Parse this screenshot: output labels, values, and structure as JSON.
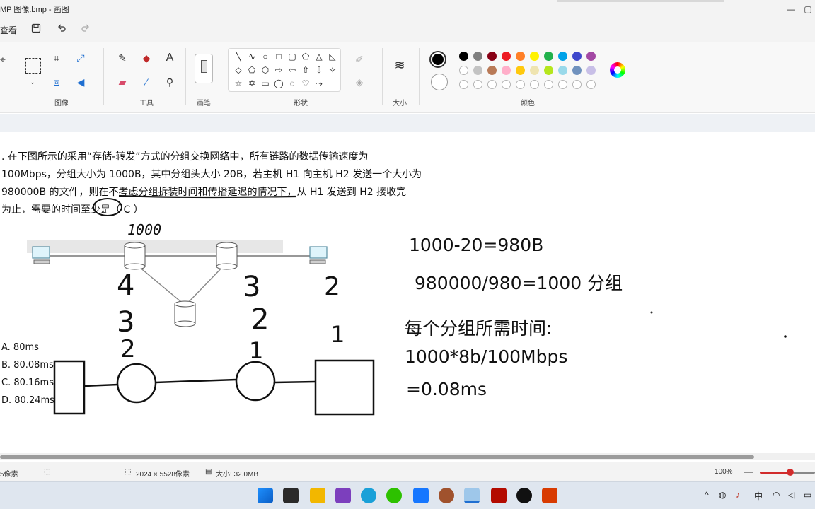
{
  "window": {
    "title": "MP 图像.bmp - 画图",
    "minimize": "—",
    "maximize": "▢"
  },
  "quickbar": {
    "view_label": "查看"
  },
  "ribbon": {
    "groups": {
      "image": "图像",
      "tools": "工具",
      "brushes": "画笔",
      "shapes": "形状",
      "size": "大小",
      "colors": "颜色"
    },
    "text_tool": "A",
    "shapes": [
      "╲",
      "∿",
      "○",
      "□",
      "▢",
      "⬠",
      "△",
      "◺",
      "◇",
      "⬠",
      "⬡",
      "⇨",
      "⇦",
      "⇧",
      "⇩",
      "✧",
      "☆",
      "✡",
      "▭",
      "◯",
      "◌",
      "♡",
      "⤳"
    ],
    "palette_row1": [
      "#000000",
      "#7f7f7f",
      "#880015",
      "#ed1c24",
      "#ff7f27",
      "#fff200",
      "#22b14c",
      "#00a2e8",
      "#3f48cc",
      "#a349a4"
    ],
    "palette_row2": [
      "#ffffff",
      "#c3c3c3",
      "#b97a57",
      "#ffaec9",
      "#ffc90e",
      "#efe4b0",
      "#b5e61d",
      "#99d9ea",
      "#7092be",
      "#c8bfe7"
    ],
    "color1": "#000000",
    "color2": "#ffffff"
  },
  "question": {
    "line1": ". 在下图所示的采用“存储-转发”方式的分组交换网络中，所有链路的数据传输速度为",
    "line2": "100Mbps，分组大小为 1000B，其中分组头大小 20B，若主机 H1 向主机 H2 发送一个大小为",
    "line3": "980000B 的文件，则在不考虑分组拆装时间和传播延迟的情况下，从 H1 发送到 H2 接收完",
    "line4": "为止，需要的时间至少是（  C  ）",
    "options": [
      "A. 80ms",
      "B. 80.08ms",
      "C. 80.16ms",
      "D. 80.24ms"
    ]
  },
  "handwriting": {
    "top": "1000",
    "n4": "4",
    "n3a": "3",
    "n2a": "2",
    "n3b": "3",
    "n2b": "2",
    "n1a": "1",
    "n2c": "2",
    "n1b": "1"
  },
  "calc": {
    "line1": "1000-20=980B",
    "line2": "980000/980=1000 分组",
    "line3": "每个分组所需时间:",
    "line4": "1000*8b/100Mbps",
    "line5": "=0.08ms"
  },
  "statusbar": {
    "left": "5像素",
    "dimensions": "2024 × 5528像素",
    "size": "大小: 32.0MB",
    "zoom": "100%"
  },
  "tray": {
    "ime": "中",
    "caret": "^"
  }
}
